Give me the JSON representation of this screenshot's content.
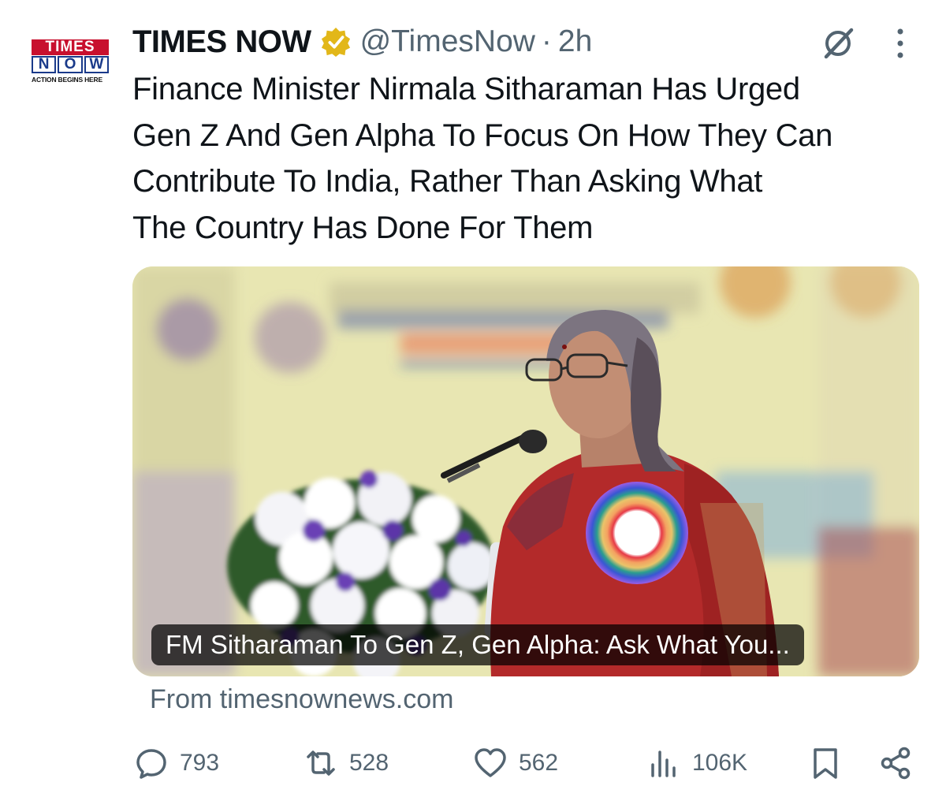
{
  "account": {
    "logo_line1": "TIMES",
    "logo_line2_letters": [
      "N",
      "O",
      "W"
    ],
    "logo_tagline": "ACTION BEGINS HERE",
    "display_name": "TIMES NOW",
    "handle": "@TimesNow",
    "separator": "·",
    "time_ago": "2h",
    "verified_badge": "gold-verified-icon"
  },
  "tweet": {
    "lines": [
      "Finance Minister Nirmala Sitharaman Has Urged",
      "Gen Z And Gen Alpha To Focus On How They Can",
      "Contribute To India, Rather Than Asking What",
      "The Country Has Done For Them"
    ]
  },
  "card": {
    "image_alt": "Nirmala Sitharaman speaking at a podium with a microphone and flowers",
    "caption": "FM Sitharaman To Gen Z, Gen Alpha: Ask What You...",
    "source": "From timesnownews.com"
  },
  "actions": {
    "replies": "793",
    "reposts": "528",
    "likes": "562",
    "views": "106K"
  },
  "icons": {
    "grok": "grok-icon",
    "more": "more-vertical-icon",
    "reply": "reply-icon",
    "repost": "repost-icon",
    "like": "heart-icon",
    "views": "views-icon",
    "bookmark": "bookmark-icon",
    "share": "share-icon"
  },
  "colors": {
    "text": "#0f1419",
    "secondary": "#536471",
    "verified_gold": "#e2b719",
    "logo_red": "#c8102e",
    "logo_blue": "#1a3a8a"
  }
}
